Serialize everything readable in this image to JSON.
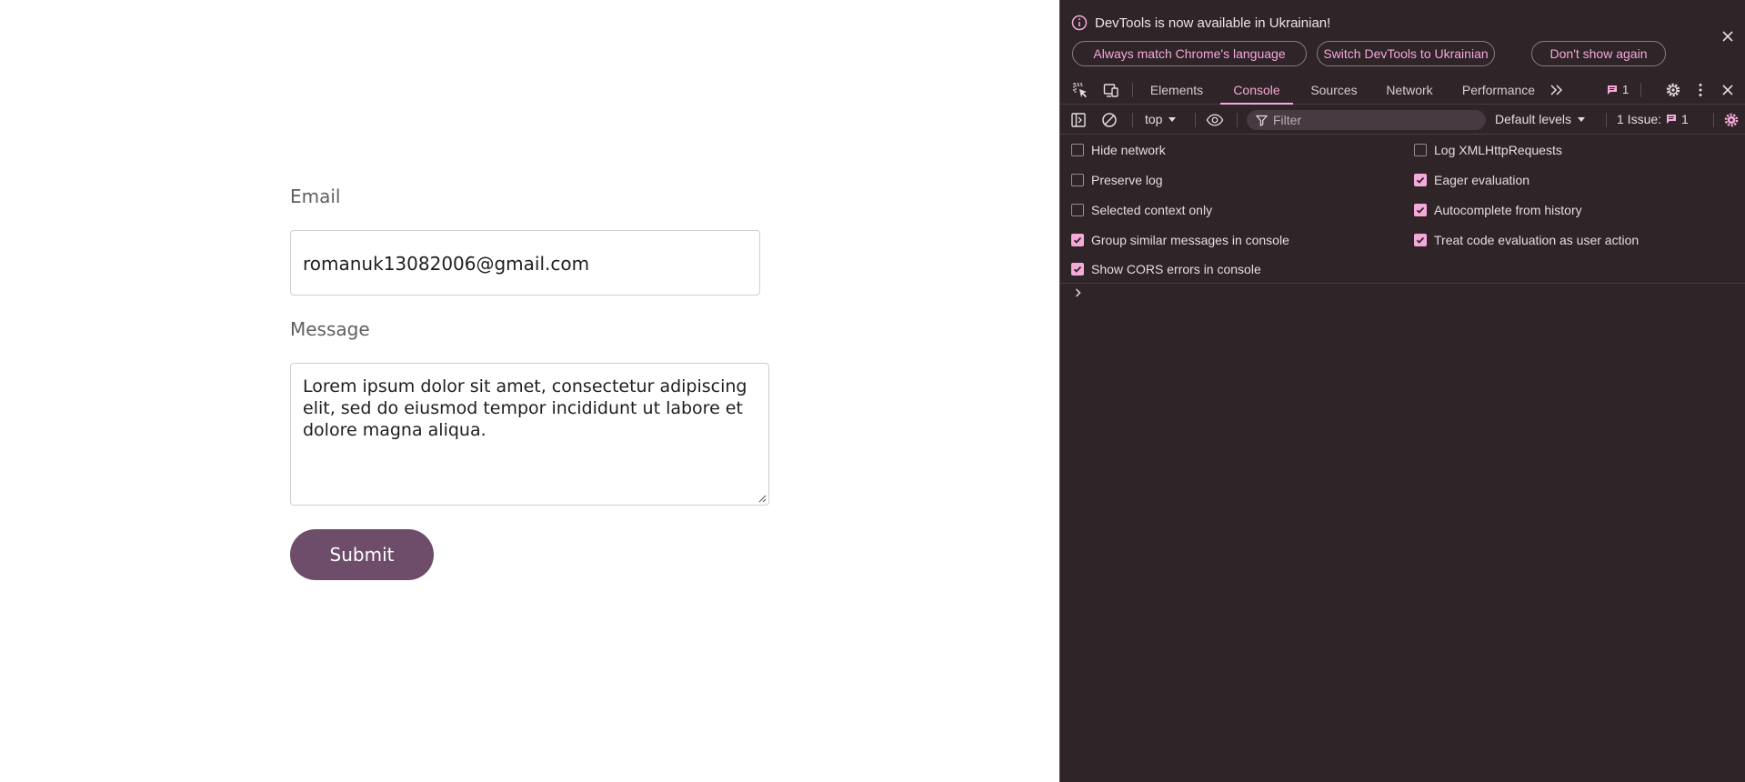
{
  "form": {
    "email_label": "Email",
    "email_value": "romanuk13082006@gmail.com",
    "message_label": "Message",
    "message_value": "Lorem ipsum dolor sit amet, consectetur adipiscing elit, sed do eiusmod tempor incididunt ut labore et dolore magna aliqua.",
    "submit_label": "Submit"
  },
  "infobar": {
    "message": "DevTools is now available in Ukrainian!",
    "buttons": {
      "match": "Always match Chrome's language",
      "switch": "Switch DevTools to Ukrainian",
      "dont_show": "Don't show again"
    }
  },
  "tabs": {
    "elements": "Elements",
    "console": "Console",
    "sources": "Sources",
    "network": "Network",
    "performance": "Performance",
    "active": "Console"
  },
  "tabbar": {
    "issues_count": "1"
  },
  "console_toolbar": {
    "context": "top",
    "filter_placeholder": "Filter",
    "levels": "Default levels",
    "issues_label": "1 Issue:",
    "issues_count": "1"
  },
  "settings": {
    "left": [
      {
        "label": "Hide network",
        "checked": false
      },
      {
        "label": "Preserve log",
        "checked": false
      },
      {
        "label": "Selected context only",
        "checked": false
      },
      {
        "label": "Group similar messages in console",
        "checked": true
      },
      {
        "label": "Show CORS errors in console",
        "checked": true
      }
    ],
    "right": [
      {
        "label": "Log XMLHttpRequests",
        "checked": false
      },
      {
        "label": "Eager evaluation",
        "checked": true
      },
      {
        "label": "Autocomplete from history",
        "checked": true
      },
      {
        "label": "Treat code evaluation as user action",
        "checked": true
      }
    ]
  },
  "colors": {
    "accent": "#f4a9d8",
    "devtools_bg": "#2f2428",
    "submit_bg": "#6e4d6a"
  }
}
